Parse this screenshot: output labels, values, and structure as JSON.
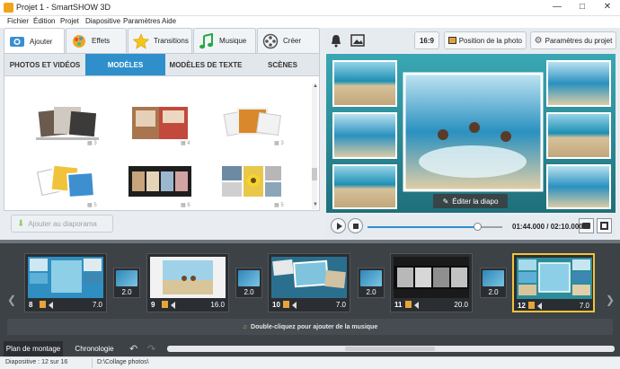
{
  "window": {
    "title": "Projet 1 - SmartSHOW 3D"
  },
  "menu": [
    "Fichier",
    "Édition",
    "Projet",
    "Diapositive",
    "Paramètres",
    "Aide"
  ],
  "toptabs": [
    {
      "label": "Ajouter"
    },
    {
      "label": "Effets"
    },
    {
      "label": "Transitions"
    },
    {
      "label": "Musique"
    },
    {
      "label": "Créer"
    }
  ],
  "subtabs": [
    "PHOTOS ET VIDÉOS",
    "MODÈLES",
    "MODÈLES DE TEXTE",
    "SCÈNES"
  ],
  "templates": [
    {
      "count": "3"
    },
    {
      "count": "4"
    },
    {
      "count": "3"
    },
    {
      "count": "5"
    },
    {
      "count": "6"
    },
    {
      "count": "5"
    }
  ],
  "add_button": "Ajouter au diaporama",
  "right_toolbar": {
    "ratio": "16:9",
    "photo_position": "Position de la photo",
    "project_settings": "Paramètres du projet"
  },
  "edit_slide": "Éditer la diapo",
  "player": {
    "time": "01:44.000 / 02:10.000",
    "progress": 0.8
  },
  "slides": [
    {
      "num": "8",
      "duration": "7.0",
      "transition": "2.0"
    },
    {
      "num": "9",
      "duration": "16.0",
      "transition": "2.0"
    },
    {
      "num": "10",
      "duration": "7.0",
      "transition": "2.0"
    },
    {
      "num": "11",
      "duration": "20.0",
      "transition": "2.0"
    },
    {
      "num": "12",
      "duration": "7.0"
    }
  ],
  "music_hint": "Double-cliquez pour ajouter de la musique",
  "bottom_tabs": [
    "Plan de montage",
    "Chronologie"
  ],
  "status": {
    "slide": "Diapositive : 12 sur 16",
    "path": "D:\\Collage photos\\"
  },
  "colors": {
    "accent": "#2e8fcb",
    "selected_border": "#f0c33a",
    "timeline_bg": "#3d4247"
  }
}
